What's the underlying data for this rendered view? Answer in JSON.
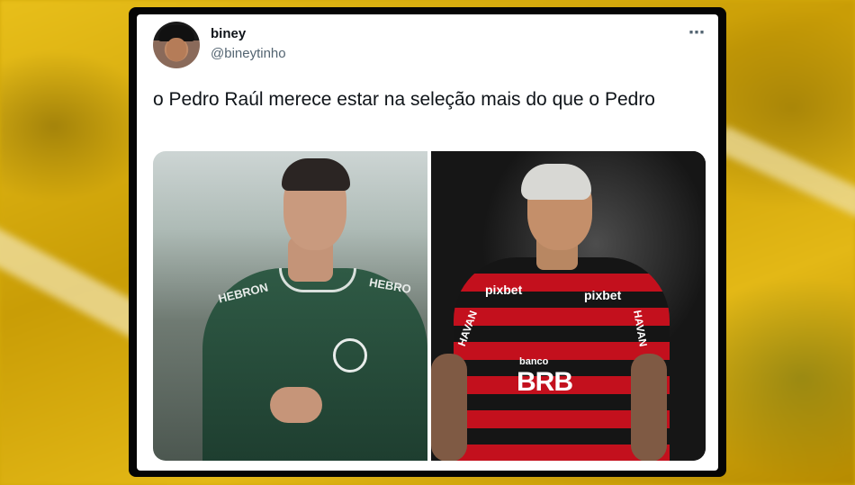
{
  "tweet": {
    "display_name": "biney",
    "handle": "@bineytinho",
    "more_icon": "⋯",
    "text": "o Pedro Raúl merece estar na seleção mais do que o Pedro"
  },
  "media": {
    "left_photo": {
      "jersey_text_left": "HEBRON",
      "jersey_text_right": "HEBRO"
    },
    "right_photo": {
      "sponsor_left": "pixbet",
      "sponsor_right": "pixbet",
      "sleeve_left": "HAVAN",
      "sleeve_right": "HAVAN",
      "banco": "banco",
      "brb": "BRB"
    }
  },
  "colors": {
    "background": "#d4a90a",
    "card": "#ffffff",
    "text_primary": "#0f1419",
    "text_secondary": "#536471"
  }
}
